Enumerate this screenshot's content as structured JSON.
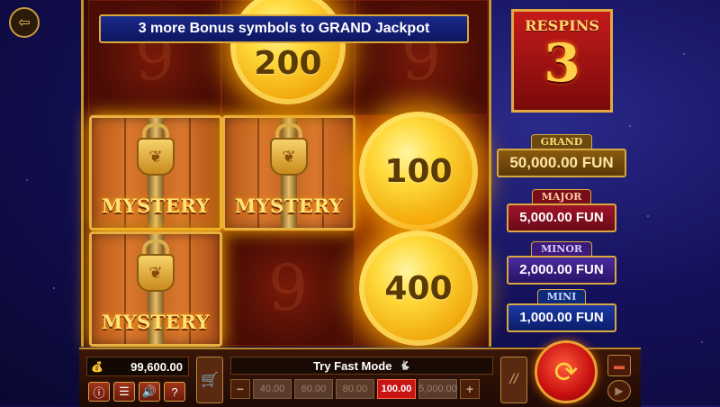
{
  "banner": {
    "text": "3 more Bonus symbols to GRAND Jackpot"
  },
  "respins": {
    "label": "RESPINS",
    "count": "3"
  },
  "jackpots": [
    {
      "tag": "GRAND",
      "value": "50,000.00 FUN"
    },
    {
      "tag": "MAJOR",
      "value": "5,000.00 FUN"
    },
    {
      "tag": "MINOR",
      "value": "2,000.00 FUN"
    },
    {
      "tag": "MINI",
      "value": "1,000.00 FUN"
    }
  ],
  "grid": {
    "mystery_label": "MYSTERY",
    "coins": [
      "200",
      "100",
      "400"
    ]
  },
  "bottom": {
    "balance": "99,600.00",
    "fast_mode": "Try Fast Mode",
    "minus": "−",
    "plus": "+",
    "bets": [
      "40.00",
      "60.00",
      "80.00",
      "100.00",
      "5,000.00"
    ],
    "active_bet_index": 3
  },
  "icons": {
    "exit": "exit-icon",
    "info": "info-icon",
    "menu": "menu-icon",
    "sound": "sound-icon",
    "help": "help-icon",
    "cart": "cart-icon",
    "turbo": "turbo-icon",
    "spin": "spin-icon",
    "autoplay": "autoplay-icon",
    "rabbit": "rabbit-icon",
    "bag": "money-bag-icon"
  }
}
